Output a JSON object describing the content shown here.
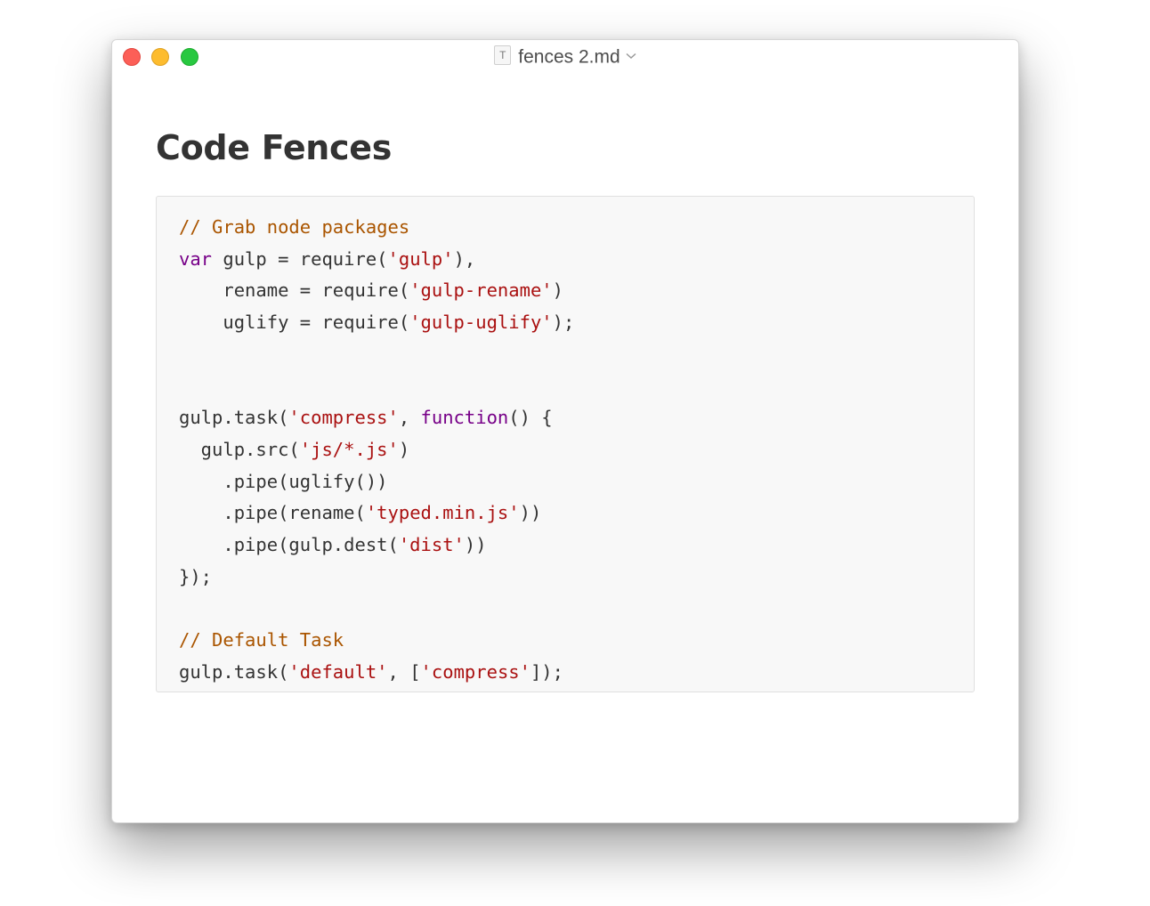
{
  "window": {
    "title": "fences 2.md",
    "doc_icon_letter": "T"
  },
  "document": {
    "heading": "Code Fences"
  },
  "code_block": {
    "lines": [
      [
        {
          "t": "// Grab node packages",
          "k": "comment"
        }
      ],
      [
        {
          "t": "var",
          "k": "keyword"
        },
        {
          "t": " gulp = require(",
          "k": "plain"
        },
        {
          "t": "'gulp'",
          "k": "string"
        },
        {
          "t": "),",
          "k": "plain"
        }
      ],
      [
        {
          "t": "    rename = require(",
          "k": "plain"
        },
        {
          "t": "'gulp-rename'",
          "k": "string"
        },
        {
          "t": ")",
          "k": "plain"
        }
      ],
      [
        {
          "t": "    uglify = require(",
          "k": "plain"
        },
        {
          "t": "'gulp-uglify'",
          "k": "string"
        },
        {
          "t": ");",
          "k": "plain"
        }
      ],
      [],
      [],
      [
        {
          "t": "gulp.task(",
          "k": "plain"
        },
        {
          "t": "'compress'",
          "k": "string"
        },
        {
          "t": ", ",
          "k": "plain"
        },
        {
          "t": "function",
          "k": "keyword"
        },
        {
          "t": "() {",
          "k": "plain"
        }
      ],
      [
        {
          "t": "  gulp.src(",
          "k": "plain"
        },
        {
          "t": "'js/*.js'",
          "k": "string"
        },
        {
          "t": ")",
          "k": "plain"
        }
      ],
      [
        {
          "t": "    .pipe(uglify())",
          "k": "plain"
        }
      ],
      [
        {
          "t": "    .pipe(rename(",
          "k": "plain"
        },
        {
          "t": "'typed.min.js'",
          "k": "string"
        },
        {
          "t": "))",
          "k": "plain"
        }
      ],
      [
        {
          "t": "    .pipe(gulp.dest(",
          "k": "plain"
        },
        {
          "t": "'dist'",
          "k": "string"
        },
        {
          "t": "))",
          "k": "plain"
        }
      ],
      [
        {
          "t": "});",
          "k": "plain"
        }
      ],
      [],
      [
        {
          "t": "// Default Task",
          "k": "comment"
        }
      ],
      [
        {
          "t": "gulp.task(",
          "k": "plain"
        },
        {
          "t": "'default'",
          "k": "string"
        },
        {
          "t": ", [",
          "k": "plain"
        },
        {
          "t": "'compress'",
          "k": "string"
        },
        {
          "t": "]);",
          "k": "plain"
        }
      ]
    ]
  },
  "colors": {
    "comment": "#aa5500",
    "keyword": "#770088",
    "string": "#aa1111",
    "plain": "#333333",
    "close": "#fc5f57",
    "minimize": "#fdbc2e",
    "zoom": "#28c840"
  },
  "icons": [
    "close-button",
    "minimize-button",
    "zoom-button",
    "document-icon",
    "chevron-down-icon"
  ]
}
